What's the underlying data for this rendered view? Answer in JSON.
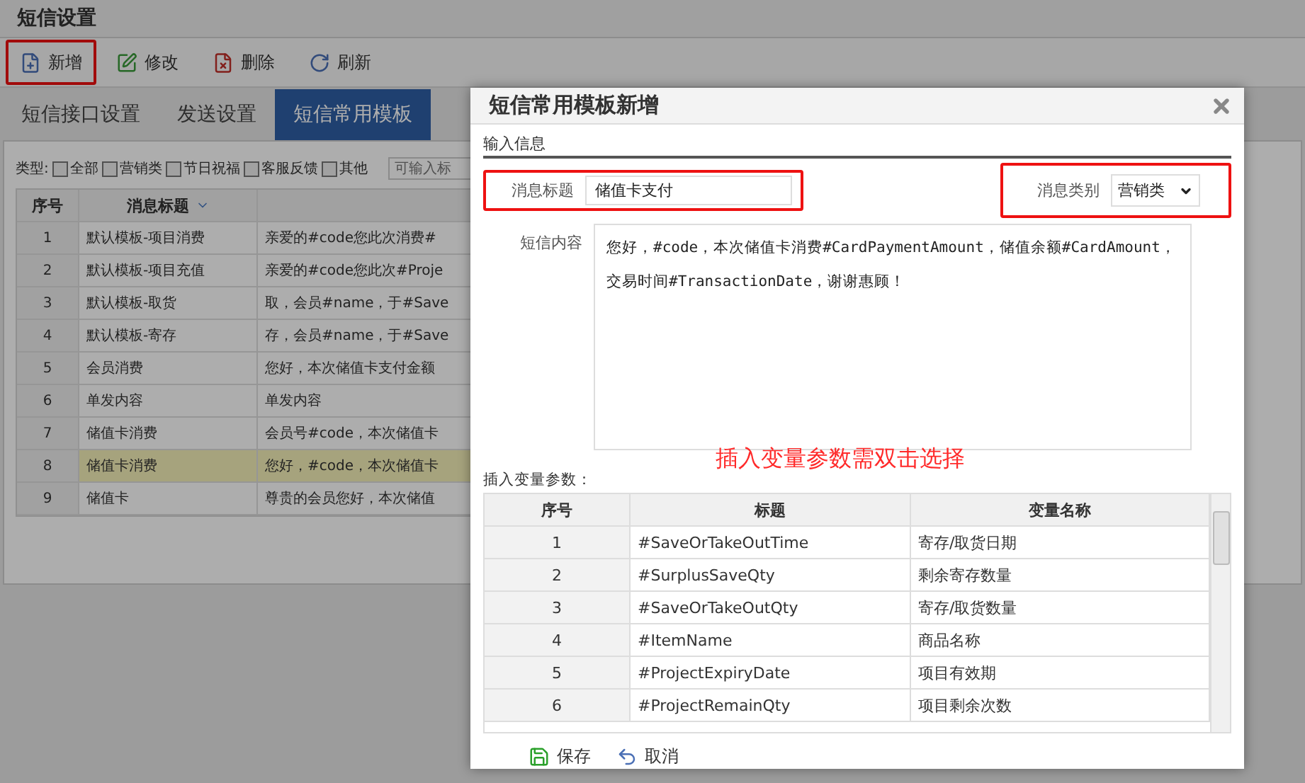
{
  "page": {
    "title": "短信设置",
    "toolbar": [
      {
        "label": "新增",
        "kind": "add",
        "highlighted": true
      },
      {
        "label": "修改",
        "kind": "edit",
        "highlighted": false
      },
      {
        "label": "删除",
        "kind": "delete",
        "highlighted": false
      },
      {
        "label": "刷新",
        "kind": "refresh",
        "highlighted": false
      }
    ],
    "tabs": [
      {
        "label": "短信接口设置",
        "selected": false
      },
      {
        "label": "发送设置",
        "selected": false
      },
      {
        "label": "短信常用模板",
        "selected": true
      }
    ],
    "filter": {
      "label": "类型:",
      "options": [
        {
          "label": "全部",
          "checked": false
        },
        {
          "label": "营销类",
          "checked": false
        },
        {
          "label": "节日祝福",
          "checked": false
        },
        {
          "label": "客服反馈",
          "checked": false
        },
        {
          "label": "其他",
          "checked": false
        }
      ],
      "search_placeholder": "可输入标"
    },
    "table": {
      "columns": [
        "序号",
        "消息标题"
      ],
      "rows": [
        {
          "cells": [
            "1",
            "默认模板-项目消费",
            "亲爱的#code您此次消费#"
          ],
          "selected": false
        },
        {
          "cells": [
            "2",
            "默认模板-项目充值",
            "亲爱的#code您此次#Proje"
          ],
          "selected": false
        },
        {
          "cells": [
            "3",
            "默认模板-取货",
            "取，会员#name，于#Save"
          ],
          "selected": false
        },
        {
          "cells": [
            "4",
            "默认模板-寄存",
            "存，会员#name，于#Save"
          ],
          "selected": false
        },
        {
          "cells": [
            "5",
            "会员消费",
            "您好，本次储值卡支付金额"
          ],
          "selected": false
        },
        {
          "cells": [
            "6",
            "单发内容",
            "单发内容"
          ],
          "selected": false
        },
        {
          "cells": [
            "7",
            "储值卡消费",
            "会员号#code，本次储值卡"
          ],
          "selected": false
        },
        {
          "cells": [
            "8",
            "储值卡消费",
            "您好，#code，本次储值卡"
          ],
          "selected": true
        },
        {
          "cells": [
            "9",
            "储值卡",
            "尊贵的会员您好，本次储值"
          ],
          "selected": false
        }
      ]
    }
  },
  "dialog": {
    "title": "短信常用模板新增",
    "section": "输入信息",
    "title_field": {
      "label": "消息标题",
      "value": "储值卡支付",
      "highlighted": true
    },
    "category_field": {
      "label": "消息类别",
      "value": "营销类",
      "highlighted": true
    },
    "content_field": {
      "label": "短信内容",
      "value": "您好，#code，本次储值卡消费#CardPaymentAmount，储值余额#CardAmount，交易时间#TransactionDate，谢谢惠顾！"
    },
    "hint": "插入变量参数需双击选择",
    "variables_label": "插入变量参数：",
    "variables": {
      "columns": [
        "序号",
        "标题",
        "变量名称"
      ],
      "rows": [
        [
          "1",
          "#SaveOrTakeOutTime",
          "寄存/取货日期"
        ],
        [
          "2",
          "#SurplusSaveQty",
          "剩余寄存数量"
        ],
        [
          "3",
          "#SaveOrTakeOutQty",
          "寄存/取货数量"
        ],
        [
          "4",
          "#ItemName",
          "商品名称"
        ],
        [
          "5",
          "#ProjectExpiryDate",
          "项目有效期"
        ],
        [
          "6",
          "#ProjectRemainQty",
          "项目剩余次数"
        ]
      ]
    },
    "buttons": [
      {
        "label": "保存",
        "kind": "save"
      },
      {
        "label": "取消",
        "kind": "cancel"
      }
    ]
  }
}
